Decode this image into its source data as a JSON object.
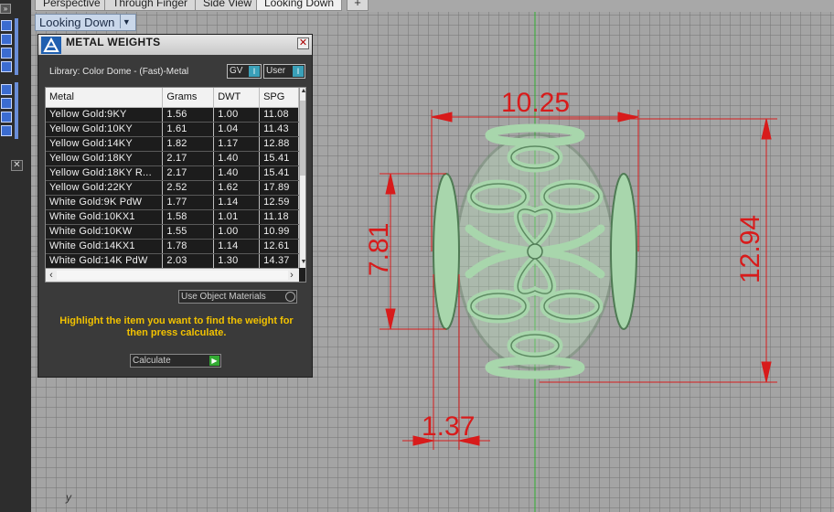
{
  "tabs": [
    {
      "label": "Perspective"
    },
    {
      "label": "Through Finger"
    },
    {
      "label": "Side View"
    },
    {
      "label": "Looking Down"
    }
  ],
  "add_tab_label": "+",
  "viewport": {
    "label": "Looking Down",
    "axis_label": "y"
  },
  "dimensions": {
    "top_width": "10.25",
    "left_height": "7.81",
    "right_height": "12.94",
    "bottom_width": "1.37"
  },
  "panel": {
    "title": "METAL WEIGHTS",
    "library_label": "Library: Color Dome - (Fast)-Metal",
    "gv_label": "GV",
    "user_label": "User",
    "columns": [
      "Metal",
      "Grams",
      "DWT",
      "SPG"
    ],
    "rows": [
      {
        "metal": "Yellow Gold:9KY",
        "grams": "1.56",
        "dwt": "1.00",
        "spg": "11.08"
      },
      {
        "metal": "Yellow Gold:10KY",
        "grams": "1.61",
        "dwt": "1.04",
        "spg": "11.43"
      },
      {
        "metal": "Yellow Gold:14KY",
        "grams": "1.82",
        "dwt": "1.17",
        "spg": "12.88"
      },
      {
        "metal": "Yellow Gold:18KY",
        "grams": "2.17",
        "dwt": "1.40",
        "spg": "15.41"
      },
      {
        "metal": "Yellow Gold:18KY R...",
        "grams": "2.17",
        "dwt": "1.40",
        "spg": "15.41"
      },
      {
        "metal": "Yellow Gold:22KY",
        "grams": "2.52",
        "dwt": "1.62",
        "spg": "17.89"
      },
      {
        "metal": "White Gold:9K PdW",
        "grams": "1.77",
        "dwt": "1.14",
        "spg": "12.59"
      },
      {
        "metal": "White Gold:10KX1",
        "grams": "1.58",
        "dwt": "1.01",
        "spg": "11.18"
      },
      {
        "metal": "White Gold:10KW",
        "grams": "1.55",
        "dwt": "1.00",
        "spg": "10.99"
      },
      {
        "metal": "White Gold:14KX1",
        "grams": "1.78",
        "dwt": "1.14",
        "spg": "12.61"
      },
      {
        "metal": "White Gold:14K PdW",
        "grams": "2.03",
        "dwt": "1.30",
        "spg": "14.37"
      }
    ],
    "use_object_materials_label": "Use Object Materials",
    "instruction": "Highlight the item you want to find the weight for then press calculate.",
    "calculate_label": "Calculate"
  },
  "colors": {
    "dimension": "#d81b1b",
    "model": "#a8d6ac",
    "instruction": "#f2c200",
    "panel_bg": "#3a3a3a"
  }
}
